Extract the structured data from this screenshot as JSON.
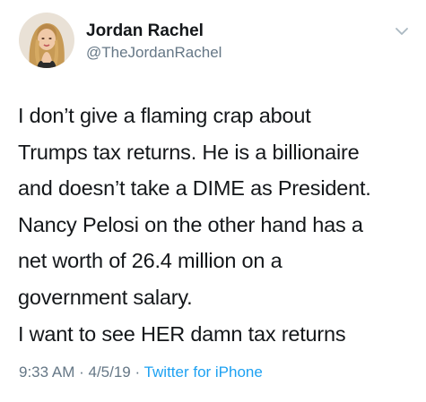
{
  "tweet": {
    "author": {
      "display_name": "Jordan Rachel",
      "handle": "@TheJordanRachel",
      "avatar_icon": "profile-photo"
    },
    "menu_icon": "chevron-down-icon",
    "text_lines": [
      "I don’t give a flaming crap about",
      "Trumps tax returns. He is a billionaire",
      "and doesn’t take a DIME as President.",
      "Nancy Pelosi on the other hand has a",
      "net worth of 26.4 million on a",
      "government salary.",
      "I want to see HER damn tax returns"
    ],
    "time": "9:33 AM",
    "separator": " · ",
    "date": "4/5/19",
    "source": "Twitter for iPhone"
  },
  "colors": {
    "text": "#14171a",
    "secondary": "#657786",
    "link": "#1da1f2"
  }
}
